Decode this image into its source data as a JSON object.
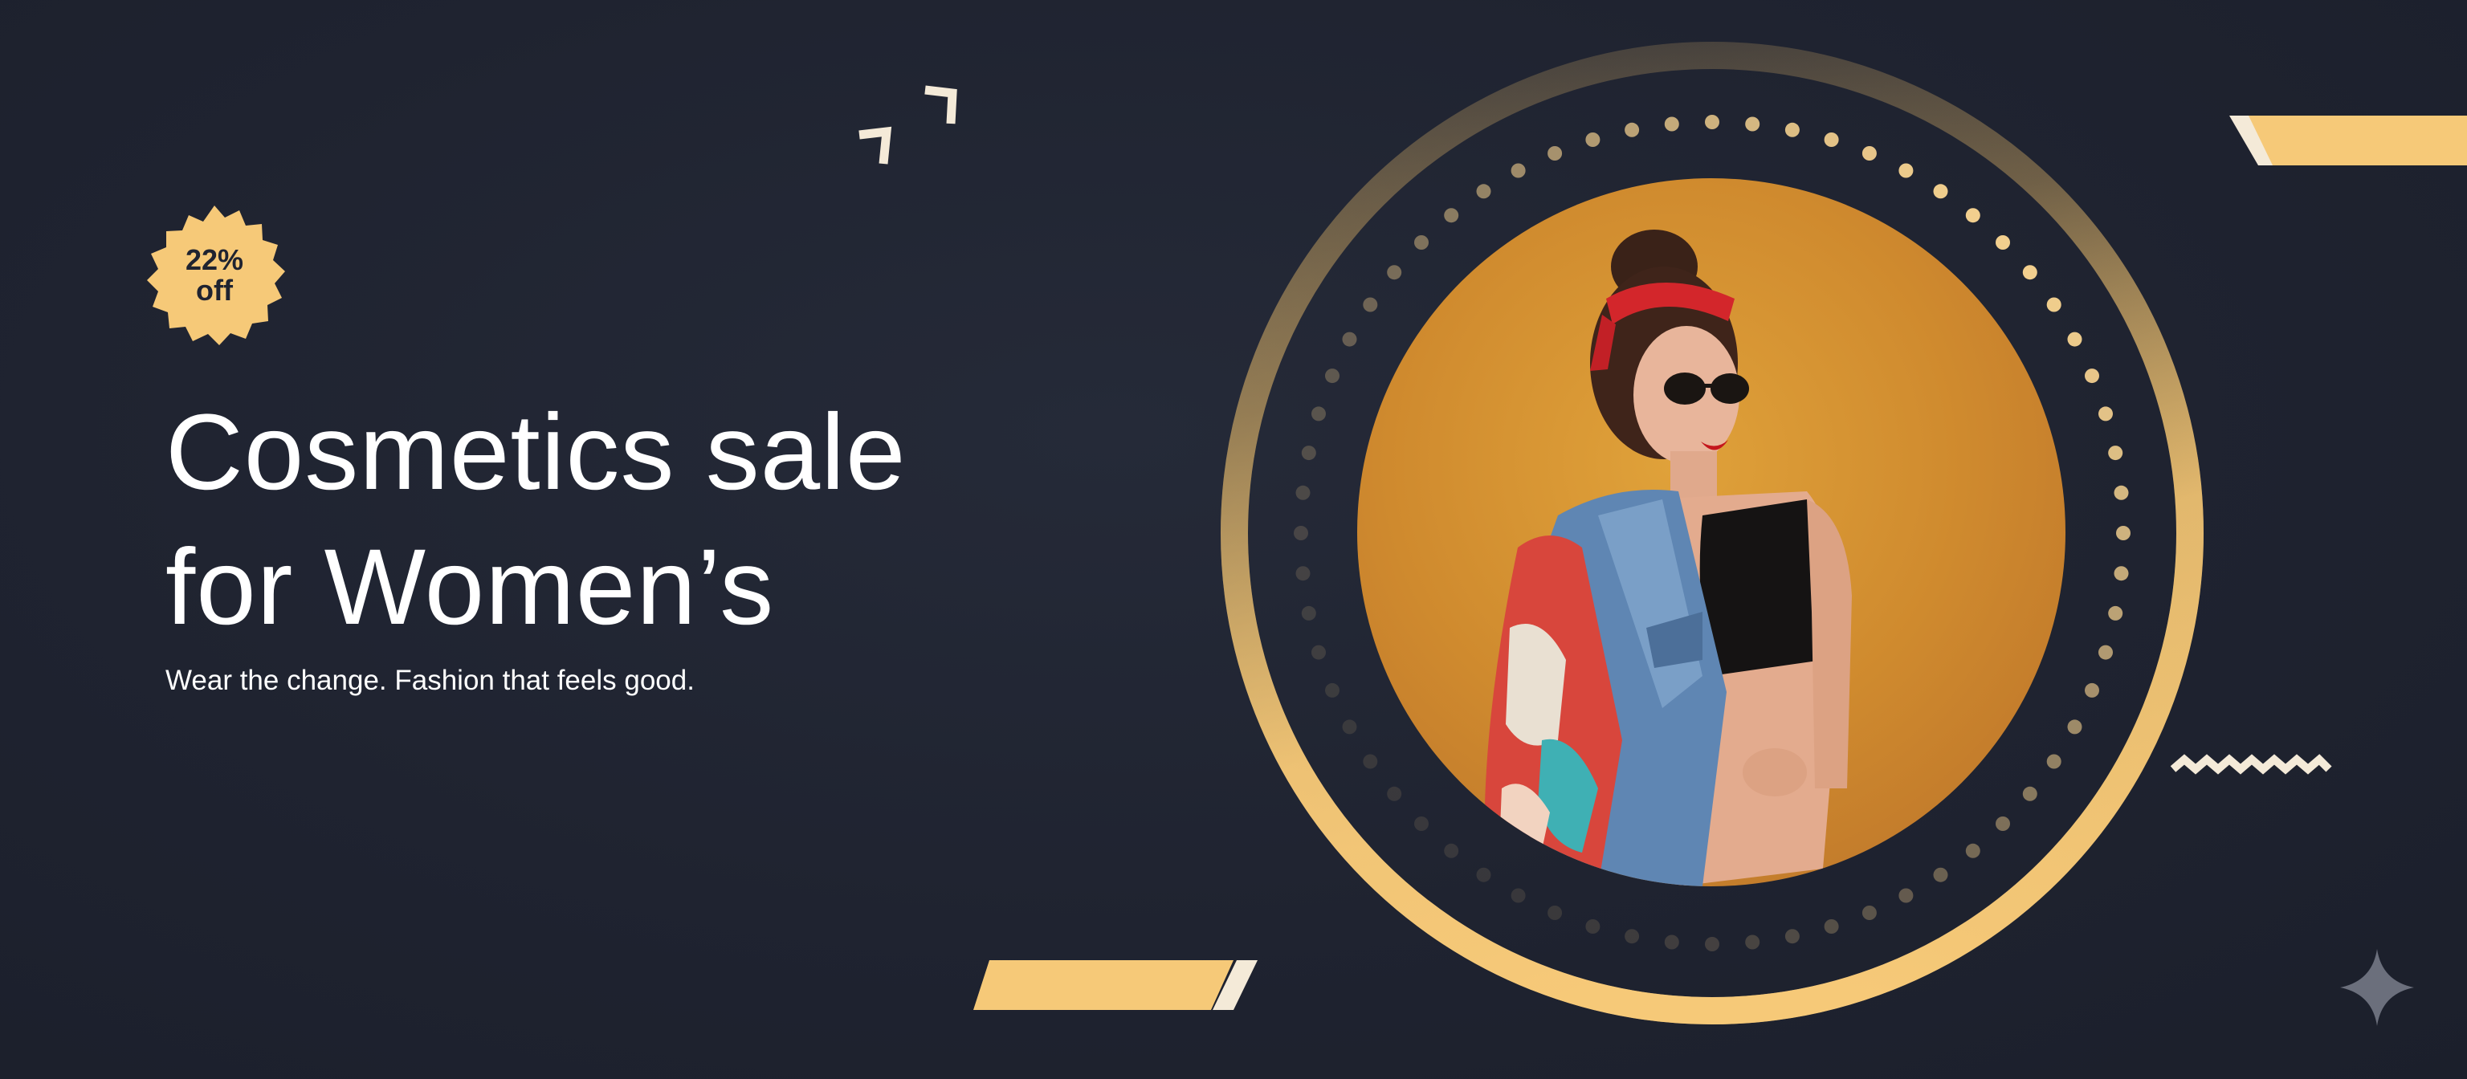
{
  "badge": {
    "line1": "22%",
    "line2": "off",
    "color": "#f6c978"
  },
  "headline": {
    "line1": "Cosmetics sale",
    "line2": "for Women’s"
  },
  "tagline": "Wear the change. Fashion that feels good.",
  "colors": {
    "background": "#1f2330",
    "accent_gold": "#f6c978",
    "photo_background": "#d8952f",
    "text": "#ffffff"
  },
  "icons": [
    "chevron-marks-icon",
    "zigzag-icon",
    "sparkle-star-icon"
  ]
}
